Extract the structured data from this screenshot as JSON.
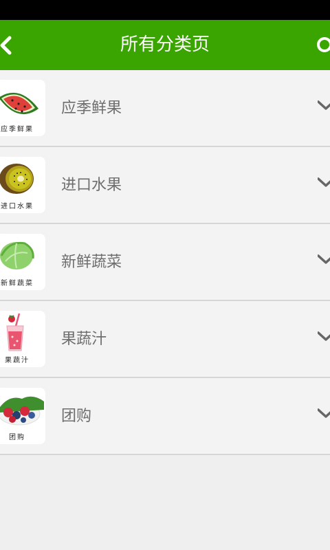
{
  "header": {
    "title": "所有分类页",
    "back_icon": "chevron-left-icon",
    "search_icon": "search-icon",
    "bg_color": "#3aa500"
  },
  "categories": [
    {
      "label": "应季鲜果",
      "thumb_caption": "应季鲜果",
      "icon": "watermelon-icon"
    },
    {
      "label": "进口水果",
      "thumb_caption": "进口水果",
      "icon": "kiwi-icon"
    },
    {
      "label": "新鲜蔬菜",
      "thumb_caption": "新鲜蔬菜",
      "icon": "cabbage-icon"
    },
    {
      "label": "果蔬汁",
      "thumb_caption": "果蔬汁",
      "icon": "juice-icon"
    },
    {
      "label": "团购",
      "thumb_caption": "团购",
      "icon": "berries-icon"
    }
  ]
}
